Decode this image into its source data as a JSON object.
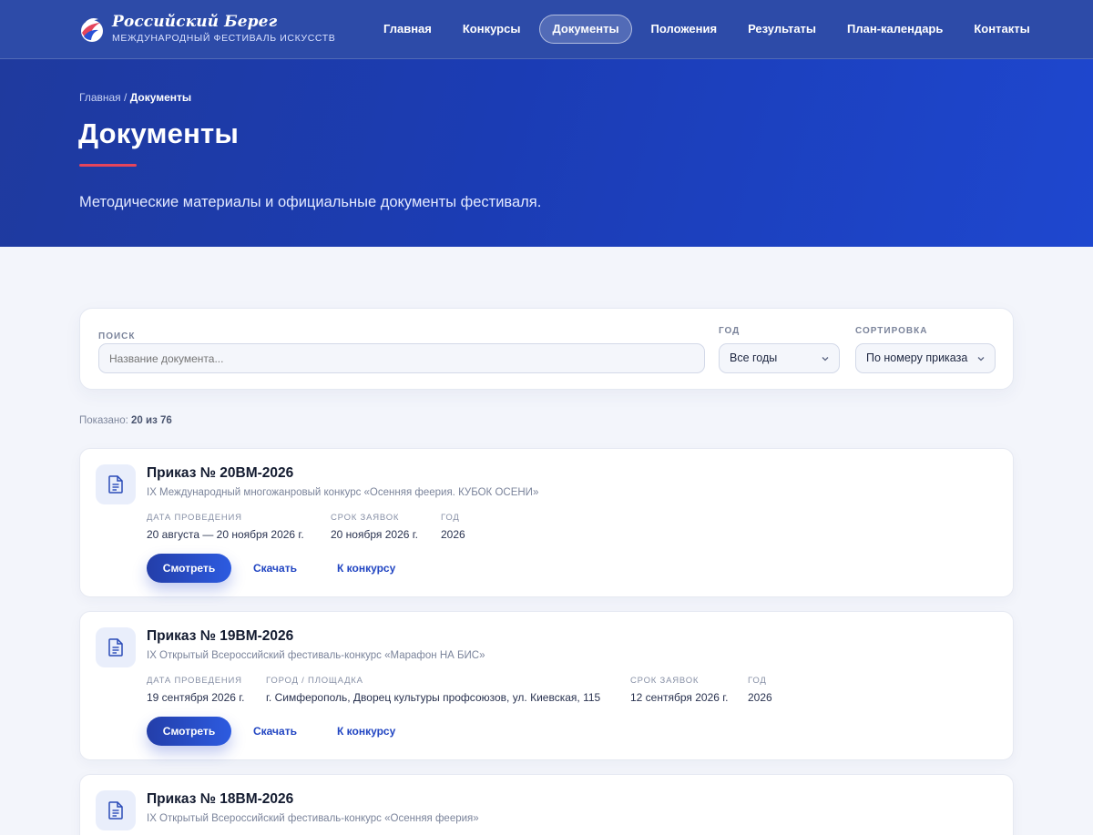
{
  "brand": {
    "title": "Российский Берег",
    "subtitle": "МЕЖДУНАРОДНЫЙ ФЕСТИВАЛЬ ИСКУССТВ",
    "colors": {
      "header": "#2d4ba8",
      "hero": "#1b3cb4",
      "accent": "#e5455c",
      "primary": "#2145c2"
    }
  },
  "nav": {
    "items": [
      {
        "label": "Главная"
      },
      {
        "label": "Конкурсы"
      },
      {
        "label": "Документы",
        "active": true
      },
      {
        "label": "Положения"
      },
      {
        "label": "Результаты"
      },
      {
        "label": "План-календарь"
      },
      {
        "label": "Контакты"
      }
    ]
  },
  "hero": {
    "breadcrumb": {
      "home": "Главная",
      "separator": " / ",
      "current": "Документы"
    },
    "title": "Документы",
    "description": "Методические материалы и официальные документы фестиваля."
  },
  "filters": {
    "search": {
      "label": "ПОИСК",
      "placeholder": "Название документа..."
    },
    "year": {
      "label": "ГОД",
      "value": "Все годы",
      "icon": "chevron-down-icon"
    },
    "sort": {
      "label": "СОРТИРОВКА",
      "value": "По номеру приказа",
      "icon": "chevron-down-icon"
    }
  },
  "results": {
    "prefix": "Показано:",
    "count": "20 из 76"
  },
  "documents": [
    {
      "title": "Приказ № 20ВМ-2026",
      "subtitle": "IX Международный многожанровый конкурс «Осенняя феерия. КУБОК ОСЕНИ»",
      "icon": "document-icon",
      "meta": [
        {
          "label": "ДАТА ПРОВЕДЕНИЯ",
          "value": "20 августа — 20 ноября 2026 г."
        },
        {
          "label": "СРОК ЗАЯВОК",
          "value": "20 ноября 2026 г."
        },
        {
          "label": "ГОД",
          "value": "2026"
        }
      ],
      "actions": {
        "view": "Смотреть",
        "download": "Скачать",
        "contest": "К конкурсу"
      }
    },
    {
      "title": "Приказ № 19ВМ-2026",
      "subtitle": "IX Открытый Всероссийский фестиваль-конкурс «Марафон НА БИС»",
      "icon": "document-icon",
      "meta": [
        {
          "label": "ДАТА ПРОВЕДЕНИЯ",
          "value": "19 сентября 2026 г."
        },
        {
          "label": "ГОРОД / ПЛОЩАДКА",
          "value": "г. Симферополь, Дворец культуры профсоюзов, ул. Киевская, 115"
        },
        {
          "label": "СРОК ЗАЯВОК",
          "value": "12 сентября 2026 г."
        },
        {
          "label": "ГОД",
          "value": "2026"
        }
      ],
      "actions": {
        "view": "Смотреть",
        "download": "Скачать",
        "contest": "К конкурсу"
      }
    },
    {
      "title": "Приказ № 18ВМ-2026",
      "subtitle": "IX Открытый Всероссийский фестиваль-конкурс «Осенняя феерия»",
      "icon": "document-icon"
    }
  ]
}
